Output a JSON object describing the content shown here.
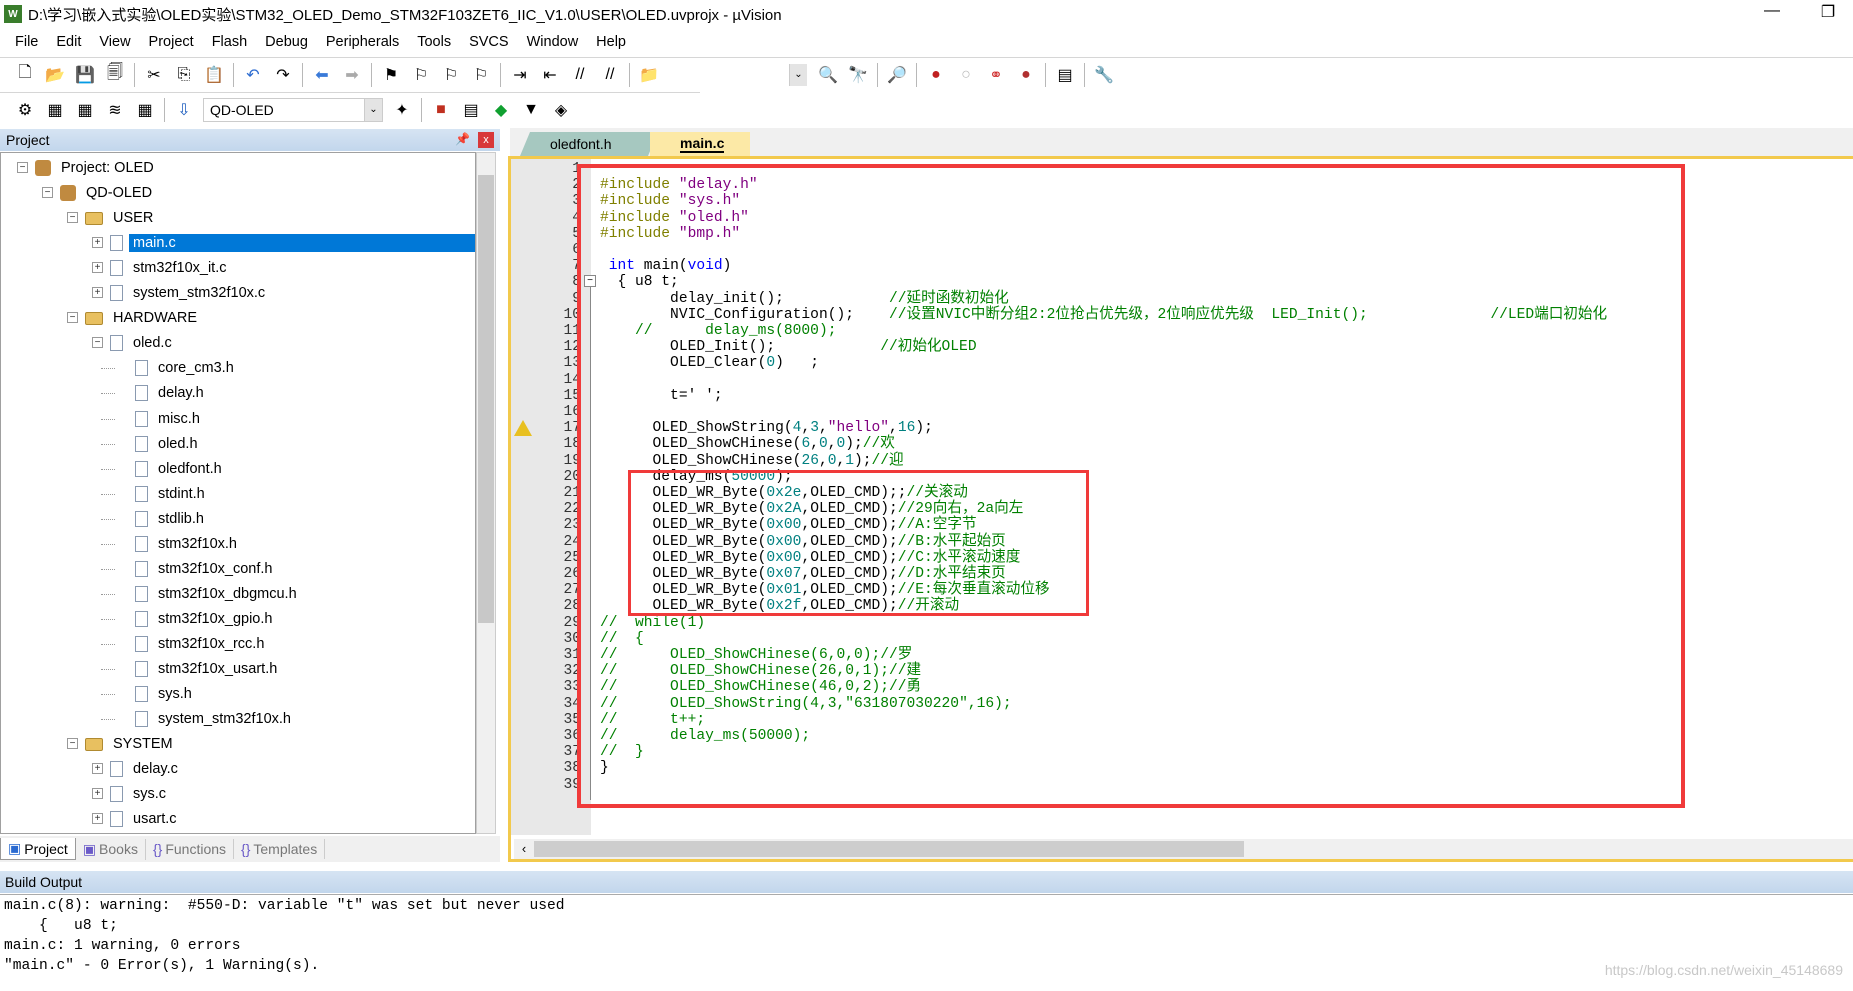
{
  "window": {
    "title": "D:\\学习\\嵌入式实验\\OLED实验\\STM32_OLED_Demo_STM32F103ZET6_IIC_V1.0\\USER\\OLED.uvprojx - µVision",
    "app_icon": "uvision-icon",
    "minimize": "—",
    "restore": "❐"
  },
  "menu": [
    "File",
    "Edit",
    "View",
    "Project",
    "Flash",
    "Debug",
    "Peripherals",
    "Tools",
    "SVCS",
    "Window",
    "Help"
  ],
  "toolbar1": [
    "new-file-icon",
    "open-icon",
    "save-icon",
    "save-all-icon",
    "|",
    "cut-icon",
    "copy-icon",
    "paste-icon",
    "|",
    "undo-icon",
    "redo-icon",
    "|",
    "nav-back-icon",
    "nav-forward-icon",
    "|",
    "bookmark-icon",
    "prev-bookmark-icon",
    "next-bookmark-icon",
    "clear-bookmarks-icon",
    "|",
    "indent-icon",
    "unindent-icon",
    "comment-icon",
    "uncomment-icon",
    "|",
    "find-in-files-icon"
  ],
  "toolbar1_right": [
    "find-dropdown",
    "incremental-find-icon",
    "find-icon",
    "|",
    "debug-session-icon",
    "|",
    "breakpoint-icon",
    "disable-breakpoint-icon",
    "disable-all-breakpoints-icon",
    "kill-breakpoints-icon",
    "|",
    "window-layout-icon",
    "|",
    "configure-icon"
  ],
  "toolbar2": [
    "translate-icon",
    "build-icon",
    "rebuild-icon",
    "batch-build-icon",
    "stop-build-icon",
    "|",
    "load-icon"
  ],
  "toolbar2_right": [
    "target-options-icon",
    "|",
    "manage-components-icon",
    "select-packs-icon",
    "pack-installer-icon",
    "manage-rte-icon",
    "event-recorder-icon"
  ],
  "target": "QD-OLED",
  "project_panel": {
    "title": "Project",
    "pin": "📌",
    "close": "x",
    "tree": [
      {
        "label": "Project: OLED",
        "depth": 0,
        "kind": "proj",
        "exp": "−"
      },
      {
        "label": "QD-OLED",
        "depth": 1,
        "kind": "proj",
        "exp": "−"
      },
      {
        "label": "USER",
        "depth": 2,
        "kind": "folder",
        "exp": "−"
      },
      {
        "label": "main.c",
        "depth": 3,
        "kind": "file",
        "exp": "+",
        "selected": true
      },
      {
        "label": "stm32f10x_it.c",
        "depth": 3,
        "kind": "file",
        "exp": "+"
      },
      {
        "label": "system_stm32f10x.c",
        "depth": 3,
        "kind": "file",
        "exp": "+"
      },
      {
        "label": "HARDWARE",
        "depth": 2,
        "kind": "folder",
        "exp": "−"
      },
      {
        "label": "oled.c",
        "depth": 3,
        "kind": "file",
        "exp": "−"
      },
      {
        "label": "core_cm3.h",
        "depth": 4,
        "kind": "file"
      },
      {
        "label": "delay.h",
        "depth": 4,
        "kind": "file"
      },
      {
        "label": "misc.h",
        "depth": 4,
        "kind": "file"
      },
      {
        "label": "oled.h",
        "depth": 4,
        "kind": "file"
      },
      {
        "label": "oledfont.h",
        "depth": 4,
        "kind": "file"
      },
      {
        "label": "stdint.h",
        "depth": 4,
        "kind": "file"
      },
      {
        "label": "stdlib.h",
        "depth": 4,
        "kind": "file"
      },
      {
        "label": "stm32f10x.h",
        "depth": 4,
        "kind": "file"
      },
      {
        "label": "stm32f10x_conf.h",
        "depth": 4,
        "kind": "file"
      },
      {
        "label": "stm32f10x_dbgmcu.h",
        "depth": 4,
        "kind": "file"
      },
      {
        "label": "stm32f10x_gpio.h",
        "depth": 4,
        "kind": "file"
      },
      {
        "label": "stm32f10x_rcc.h",
        "depth": 4,
        "kind": "file"
      },
      {
        "label": "stm32f10x_usart.h",
        "depth": 4,
        "kind": "file"
      },
      {
        "label": "sys.h",
        "depth": 4,
        "kind": "file"
      },
      {
        "label": "system_stm32f10x.h",
        "depth": 4,
        "kind": "file"
      },
      {
        "label": "SYSTEM",
        "depth": 2,
        "kind": "folder",
        "exp": "−"
      },
      {
        "label": "delay.c",
        "depth": 3,
        "kind": "file",
        "exp": "+"
      },
      {
        "label": "sys.c",
        "depth": 3,
        "kind": "file",
        "exp": "+"
      },
      {
        "label": "usart.c",
        "depth": 3,
        "kind": "file",
        "exp": "+"
      }
    ],
    "tabs": [
      {
        "label": "Project",
        "icon": "project-icon",
        "active": true
      },
      {
        "label": "Books",
        "icon": "books-icon"
      },
      {
        "label": "Functions",
        "icon": "functions-icon",
        "glyph": "{}"
      },
      {
        "label": "Templates",
        "icon": "templates-icon",
        "glyph": "{}"
      }
    ]
  },
  "editor": {
    "tabs": [
      {
        "label": "oledfont.h",
        "active": false
      },
      {
        "label": "main.c",
        "active": true
      }
    ],
    "warning_line": 17,
    "lines": [
      [],
      [
        [
          "pp",
          "#include "
        ],
        [
          "str",
          "\"delay.h\""
        ]
      ],
      [
        [
          "pp",
          "#include "
        ],
        [
          "str",
          "\"sys.h\""
        ]
      ],
      [
        [
          "pp",
          "#include "
        ],
        [
          "str",
          "\"oled.h\""
        ]
      ],
      [
        [
          "pp",
          "#include "
        ],
        [
          "str",
          "\"bmp.h\""
        ]
      ],
      [],
      [
        [
          "pl",
          " "
        ],
        [
          "kw",
          "int"
        ],
        [
          "pl",
          " main("
        ],
        [
          "kw",
          "void"
        ],
        [
          "pl",
          ")"
        ]
      ],
      [
        [
          "pl",
          "  { u8 t;"
        ]
      ],
      [
        [
          "pl",
          "        delay_init();            "
        ],
        [
          "cm",
          "//延时函数初始化"
        ]
      ],
      [
        [
          "pl",
          "        NVIC_Configuration();    "
        ],
        [
          "cm",
          "//设置NVIC中断分组2:2位抢占优先级，2位响应优先级  LED_Init();              //LED端口初始化"
        ]
      ],
      [
        [
          "cm",
          "    //      delay_ms(8000);"
        ]
      ],
      [
        [
          "pl",
          "        OLED_Init();            "
        ],
        [
          "cm",
          "//初始化OLED"
        ]
      ],
      [
        [
          "pl",
          "        OLED_Clear("
        ],
        [
          "num",
          "0"
        ],
        [
          "pl",
          ")   ;"
        ]
      ],
      [],
      [
        [
          "pl",
          "        t=' ';"
        ]
      ],
      [],
      [
        [
          "pl",
          "      OLED_ShowString("
        ],
        [
          "num",
          "4"
        ],
        [
          "pl",
          ","
        ],
        [
          "num",
          "3"
        ],
        [
          "pl",
          ","
        ],
        [
          "str",
          "\"hello\""
        ],
        [
          "pl",
          ","
        ],
        [
          "num",
          "16"
        ],
        [
          "pl",
          ");"
        ]
      ],
      [
        [
          "pl",
          "      OLED_ShowCHinese("
        ],
        [
          "num",
          "6"
        ],
        [
          "pl",
          ","
        ],
        [
          "num",
          "0"
        ],
        [
          "pl",
          ","
        ],
        [
          "num",
          "0"
        ],
        [
          "pl",
          ");"
        ],
        [
          "cm",
          "//欢"
        ]
      ],
      [
        [
          "pl",
          "      OLED_ShowCHinese("
        ],
        [
          "num",
          "26"
        ],
        [
          "pl",
          ","
        ],
        [
          "num",
          "0"
        ],
        [
          "pl",
          ","
        ],
        [
          "num",
          "1"
        ],
        [
          "pl",
          ");"
        ],
        [
          "cm",
          "//迎"
        ]
      ],
      [
        [
          "pl",
          "      delay_ms("
        ],
        [
          "num",
          "50000"
        ],
        [
          "pl",
          ");"
        ]
      ],
      [
        [
          "pl",
          "      OLED_WR_Byte("
        ],
        [
          "num",
          "0x2e"
        ],
        [
          "pl",
          ",OLED_CMD);;"
        ],
        [
          "cm",
          "//关滚动"
        ]
      ],
      [
        [
          "pl",
          "      OLED_WR_Byte("
        ],
        [
          "num",
          "0x2A"
        ],
        [
          "pl",
          ",OLED_CMD);"
        ],
        [
          "cm",
          "//29向右，2a向左"
        ]
      ],
      [
        [
          "pl",
          "      OLED_WR_Byte("
        ],
        [
          "num",
          "0x00"
        ],
        [
          "pl",
          ",OLED_CMD);"
        ],
        [
          "cm",
          "//A:空字节"
        ]
      ],
      [
        [
          "pl",
          "      OLED_WR_Byte("
        ],
        [
          "num",
          "0x00"
        ],
        [
          "pl",
          ",OLED_CMD);"
        ],
        [
          "cm",
          "//B:水平起始页"
        ]
      ],
      [
        [
          "pl",
          "      OLED_WR_Byte("
        ],
        [
          "num",
          "0x00"
        ],
        [
          "pl",
          ",OLED_CMD);"
        ],
        [
          "cm",
          "//C:水平滚动速度"
        ]
      ],
      [
        [
          "pl",
          "      OLED_WR_Byte("
        ],
        [
          "num",
          "0x07"
        ],
        [
          "pl",
          ",OLED_CMD);"
        ],
        [
          "cm",
          "//D:水平结束页"
        ]
      ],
      [
        [
          "pl",
          "      OLED_WR_Byte("
        ],
        [
          "num",
          "0x01"
        ],
        [
          "pl",
          ",OLED_CMD);"
        ],
        [
          "cm",
          "//E:每次垂直滚动位移"
        ]
      ],
      [
        [
          "pl",
          "      OLED_WR_Byte("
        ],
        [
          "num",
          "0x2f"
        ],
        [
          "pl",
          ",OLED_CMD);"
        ],
        [
          "cm",
          "//开滚动"
        ]
      ],
      [
        [
          "cm",
          "//  while(1)"
        ]
      ],
      [
        [
          "cm",
          "//  {"
        ]
      ],
      [
        [
          "cm",
          "//      OLED_ShowCHinese(6,0,0);//罗"
        ]
      ],
      [
        [
          "cm",
          "//      OLED_ShowCHinese(26,0,1);//建"
        ]
      ],
      [
        [
          "cm",
          "//      OLED_ShowCHinese(46,0,2);//勇"
        ]
      ],
      [
        [
          "cm",
          "//      OLED_ShowString(4,3,\"631807030220\",16);"
        ]
      ],
      [
        [
          "cm",
          "//      t++;"
        ]
      ],
      [
        [
          "cm",
          "//      delay_ms(50000);"
        ]
      ],
      [
        [
          "cm",
          "//  }"
        ]
      ],
      [
        [
          "pl",
          "}"
        ]
      ],
      []
    ]
  },
  "build_output": {
    "title": "Build Output",
    "lines": [
      "main.c(8): warning:  #550-D: variable \"t\" was set but never used",
      "    {   u8 t;",
      "main.c: 1 warning, 0 errors",
      "\"main.c\" - 0 Error(s), 1 Warning(s)."
    ]
  },
  "watermark": "https://blog.csdn.net/weixin_45148689",
  "colors": {
    "annotation_box": "#f03a3a",
    "selection": "#0078d7",
    "active_tab": "#fce9a6"
  }
}
